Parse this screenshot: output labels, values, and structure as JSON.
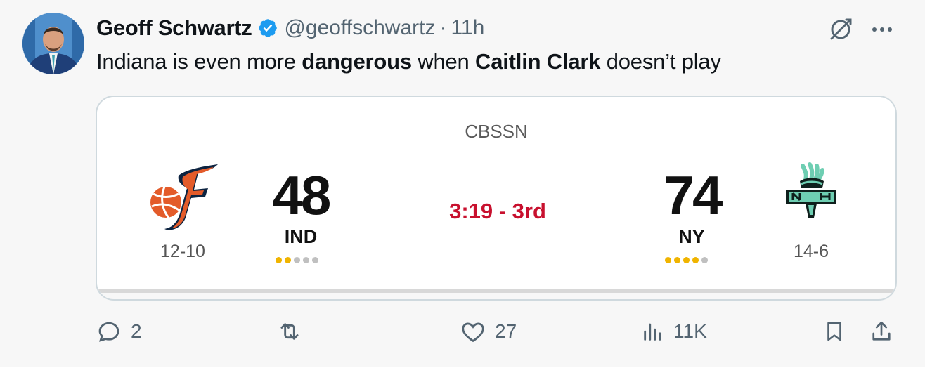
{
  "author": {
    "name": "Geoff Schwartz",
    "handle": "@geoffschwartz",
    "separator": "·",
    "time": "11h",
    "verified": true
  },
  "tweet": {
    "segments": [
      {
        "text": "Indiana is even more ",
        "bold": false
      },
      {
        "text": "dangerous",
        "bold": true
      },
      {
        "text": " when ",
        "bold": false
      },
      {
        "text": "Caitlin Clark",
        "bold": true
      },
      {
        "text": " doesn’t play",
        "bold": false
      }
    ]
  },
  "card": {
    "network": "CBSSN",
    "clock": "3:19 - 3rd",
    "home": {
      "abbr": "IND",
      "score": "48",
      "record": "12-10",
      "timeouts_remaining": 2,
      "timeouts_total": 5,
      "logo": "indiana-fever-logo"
    },
    "away": {
      "abbr": "NY",
      "score": "74",
      "record": "14-6",
      "timeouts_remaining": 4,
      "timeouts_total": 5,
      "logo": "new-york-liberty-logo"
    }
  },
  "actions": {
    "replies": "2",
    "retweets": "",
    "likes": "27",
    "views": "11K"
  },
  "colors": {
    "accent_verified": "#1d9bf0",
    "clock_red": "#c8102e",
    "timeout_on": "#f0b400",
    "timeout_off": "#c0c0c0",
    "secondary_text": "#536471"
  },
  "icons": {
    "reply": "reply-icon",
    "retweet": "retweet-icon",
    "like": "heart-icon",
    "views": "views-icon",
    "bookmark": "bookmark-icon",
    "share": "share-icon",
    "grok": "grok-icon",
    "more": "more-icon"
  }
}
